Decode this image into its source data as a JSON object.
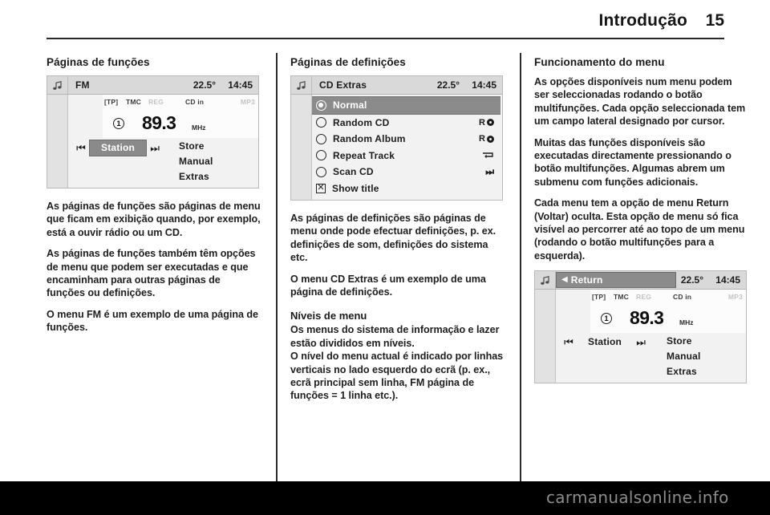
{
  "header": {
    "title": "Introdução",
    "page_number": "15"
  },
  "columns": {
    "col1": {
      "heading": "Páginas de funções",
      "display": {
        "note_icon": "music-note-icon",
        "source": "FM",
        "temperature": "22.5°",
        "clock": "14:45",
        "indicators": [
          {
            "label": "[TP]",
            "dim": false
          },
          {
            "label": "TMC",
            "dim": false
          },
          {
            "label": "REG",
            "dim": true
          },
          {
            "label": "CD in",
            "dim": false
          },
          {
            "label": "MP3",
            "dim": true
          }
        ],
        "preset": "1",
        "frequency": "89.3",
        "unit": "MHz",
        "prev_icon": "skip-previous-icon",
        "next_icon": "skip-next-icon",
        "station_label": "Station",
        "station_selected": true,
        "options": [
          "Store",
          "Manual",
          "Extras"
        ]
      },
      "paragraphs": [
        "As páginas de funções são páginas de menu que ficam em exibição quando, por exemplo, está a ouvir rádio ou um CD.",
        "As páginas de funções também têm opções de menu que podem ser executadas e que encaminham para outras páginas de funções ou definições.",
        "O menu FM é um exemplo de uma página de funções."
      ]
    },
    "col2": {
      "heading": "Páginas de definições",
      "display": {
        "note_icon": "music-note-icon",
        "source": "CD Extras",
        "temperature": "22.5°",
        "clock": "14:45",
        "items": [
          {
            "label": "Normal",
            "control": "radio",
            "selected": true,
            "badge": ""
          },
          {
            "label": "Random CD",
            "control": "radio",
            "selected": false,
            "badge": "R",
            "badge_icon": "disc-icon"
          },
          {
            "label": "Random Album",
            "control": "radio",
            "selected": false,
            "badge": "R",
            "badge_icon": "disc-icon"
          },
          {
            "label": "Repeat Track",
            "control": "radio",
            "selected": false,
            "badge": "",
            "badge_icon": "repeat-icon"
          },
          {
            "label": "Scan CD",
            "control": "radio",
            "selected": false,
            "badge": "",
            "badge_icon": "skip-next-icon"
          },
          {
            "label": "Show title",
            "control": "checkbox",
            "selected": false,
            "badge": ""
          }
        ]
      },
      "paragraphs": [
        "As páginas de definições são páginas de menu onde pode efectuar definições, p. ex. definições de som, definições do sistema etc.",
        "O menu CD Extras é um exemplo de uma página de definições."
      ],
      "subheading": "Níveis de menu",
      "sub_paragraphs": [
        "Os menus do sistema de informação e lazer estão divididos em níveis.",
        "O nível do menu actual é indicado por linhas verticais no lado esquerdo do ecrã (p. ex., ecrã principal sem linha, FM página de funções = 1 linha etc.)."
      ]
    },
    "col3": {
      "heading": "Funcionamento do menu",
      "paragraphs": [
        "As opções disponíveis num menu podem ser seleccionadas rodando o botão multifunções. Cada opção seleccionada tem um campo lateral designado por cursor.",
        "Muitas das funções disponíveis são executadas directamente pressionando o botão multifunções. Algumas abrem um submenu com funções adicionais.",
        "Cada menu tem a opção de menu Return (Voltar) oculta. Esta opção de menu só fica visível ao percorrer até ao topo de um menu (rodando o botão multifunções para a esquerda)."
      ],
      "display": {
        "note_icon": "music-note-icon",
        "return_label": "Return",
        "return_arrow_icon": "arrow-left-icon",
        "return_selected": true,
        "temperature": "22.5°",
        "clock": "14:45",
        "indicators": [
          {
            "label": "[TP]",
            "dim": false
          },
          {
            "label": "TMC",
            "dim": false
          },
          {
            "label": "REG",
            "dim": true
          },
          {
            "label": "CD in",
            "dim": false
          },
          {
            "label": "MP3",
            "dim": true
          }
        ],
        "preset": "1",
        "frequency": "89.3",
        "unit": "MHz",
        "prev_icon": "skip-previous-icon",
        "next_icon": "skip-next-icon",
        "station_label": "Station",
        "station_selected": false,
        "options": [
          "Store",
          "Manual",
          "Extras"
        ]
      }
    }
  },
  "watermark": {
    "text": "carmanualsonline.info"
  }
}
